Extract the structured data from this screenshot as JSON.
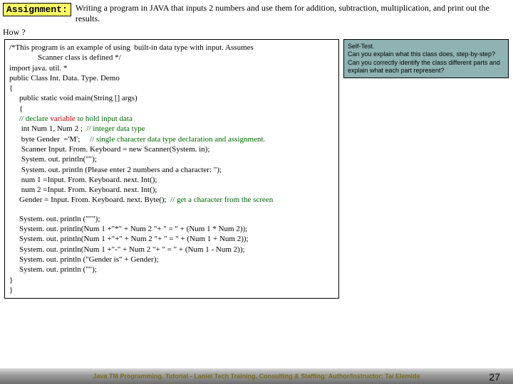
{
  "header": {
    "assignment_label": "Assignment:",
    "assignment_text": "Writing a program in JAVA that inputs 2 numbers and use them for addition, subtraction, multiplication, and print out the results.",
    "how_label": "How ?"
  },
  "code": {
    "c01": "/*This program is an example of using  built-in data type with input. Assumes",
    "c01b": "Scanner class is defined */",
    "c02": "import java. util. *",
    "c03": "public Class Int. Data. Type. Demo",
    "c04": "{",
    "c05": "public static void main(String [] args)",
    "c06": "{",
    "c07a": "// declare ",
    "c07b": "variable",
    "c07c": " to hold input data",
    "c08a": " int Num 1, Num 2 ;  ",
    "c08b": "// integer data type",
    "c09a": " byte Gender  ='M';     ",
    "c09b": "// single character data type declaration and assignment.",
    "c10": " Scanner Input. From. Keyboard = new Scanner(System. in);",
    "c11": " System. out. println(\"\");",
    "c12": " System. out. println (Please enter 2 numbers and a character: \");",
    "c13": " num 1 =Input. From. Keyboard. next. Int();",
    "c14": " num 2 =Input. From. Keyboard. next. Int();",
    "c15a": "Gender = Input. From. Keyboard. next. Byte();  ",
    "c15b": "// get a character from the screen",
    "c16": "System. out. println (\"\"\");",
    "c17": "System. out. println(Num 1 +\"*\" + Num 2 \"+ \" = \" + (Num 1 * Num 2));",
    "c18": "System. out. println(Num 1 +\"+\" + Num 2 \"+ \" = \" + (Num 1 + Num 2));",
    "c19": "System. out. println(Num 1 +\"-\" + Num 2 \"+ \" = \" + (Num 1 - Num 2));",
    "c20": "System. out. println (\"Gender is\" + Gender);",
    "c21": "System. out. println (\"\");",
    "c22": "}",
    "c23": "}"
  },
  "selftest": {
    "l1": "Self-Test.",
    "l2": "Can you explain what this class does, step-by-step?",
    "l3": "Can you correctly identify the class different parts and explain what each part represent?"
  },
  "footer": {
    "text": "Java TM Programming. Tutorial  -  Laniel Tech Training, Consulting & Staffing: Author/Instructor: Tai Elemide",
    "page": "27"
  }
}
